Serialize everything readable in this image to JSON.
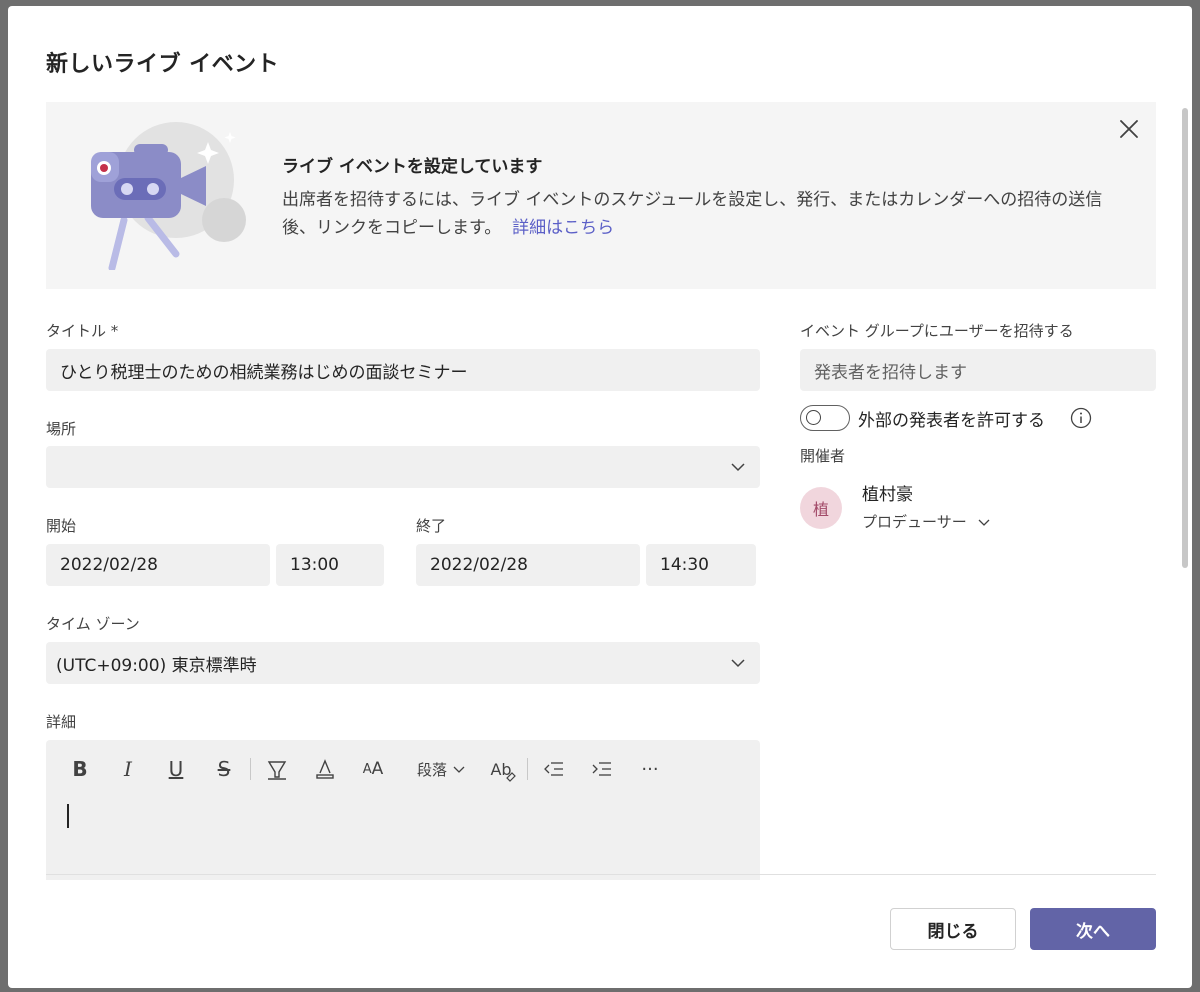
{
  "dialog": {
    "title": "新しいライブ イベント",
    "close_icon": "close-icon"
  },
  "banner": {
    "heading": "ライブ イベントを設定しています",
    "body": "出席者を招待するには、ライブ イベントのスケジュールを設定し、発行、またはカレンダーへの招待の送信後、リンクをコピーします。",
    "link": "詳細はこちら",
    "illustration": "video-camera-illustration"
  },
  "form": {
    "title_label": "タイトル *",
    "title_value": "ひとり税理士のための相続業務はじめの面談セミナー",
    "location_label": "場所",
    "location_value": "",
    "start_label": "開始",
    "start_date": "2022/02/28",
    "start_time": "13:00",
    "end_label": "終了",
    "end_date": "2022/02/28",
    "end_time": "14:30",
    "timezone_label": "タイム ゾーン",
    "timezone_value": "(UTC+09:00) 東京標準時",
    "details_label": "詳細"
  },
  "editor_toolbar": {
    "items": [
      "bold-icon",
      "italic-icon",
      "underline-icon",
      "strikethrough-icon",
      "highlight-icon",
      "font-color-icon",
      "font-size-icon",
      "paragraph-dropdown",
      "clear-formatting-icon",
      "decrease-indent-icon",
      "increase-indent-icon",
      "more-icon"
    ],
    "paragraph_label": "段落"
  },
  "invite": {
    "label": "イベント グループにユーザーを招待する",
    "placeholder": "発表者を招待します",
    "toggle_label": "外部の発表者を許可する",
    "toggle_on": false
  },
  "organizer": {
    "label": "開催者",
    "avatar_initial": "植",
    "name": "植村豪",
    "role": "プロデューサー"
  },
  "footer": {
    "close_label": "閉じる",
    "next_label": "次へ"
  },
  "colors": {
    "accent": "#6264a7",
    "link": "#5b5fc7",
    "avatar_bg": "#f1d6dd",
    "avatar_fg": "#a24a68"
  }
}
